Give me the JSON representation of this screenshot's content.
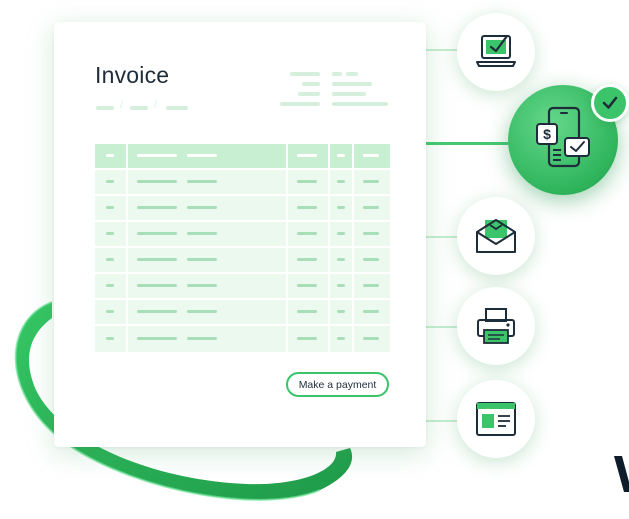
{
  "invoice": {
    "title": "Invoice",
    "pay_button_label": "Make a payment"
  },
  "colors": {
    "accent": "#3bc46a",
    "accent_light": "#c8efd2",
    "row_fill": "#ecf9ef",
    "text_dark": "#1e2d3a"
  },
  "channel_icons": [
    "laptop-check-icon",
    "mobile-payment-icon",
    "email-envelope-icon",
    "printer-icon",
    "web-browser-icon"
  ],
  "badge_icon": "checkmark-icon"
}
